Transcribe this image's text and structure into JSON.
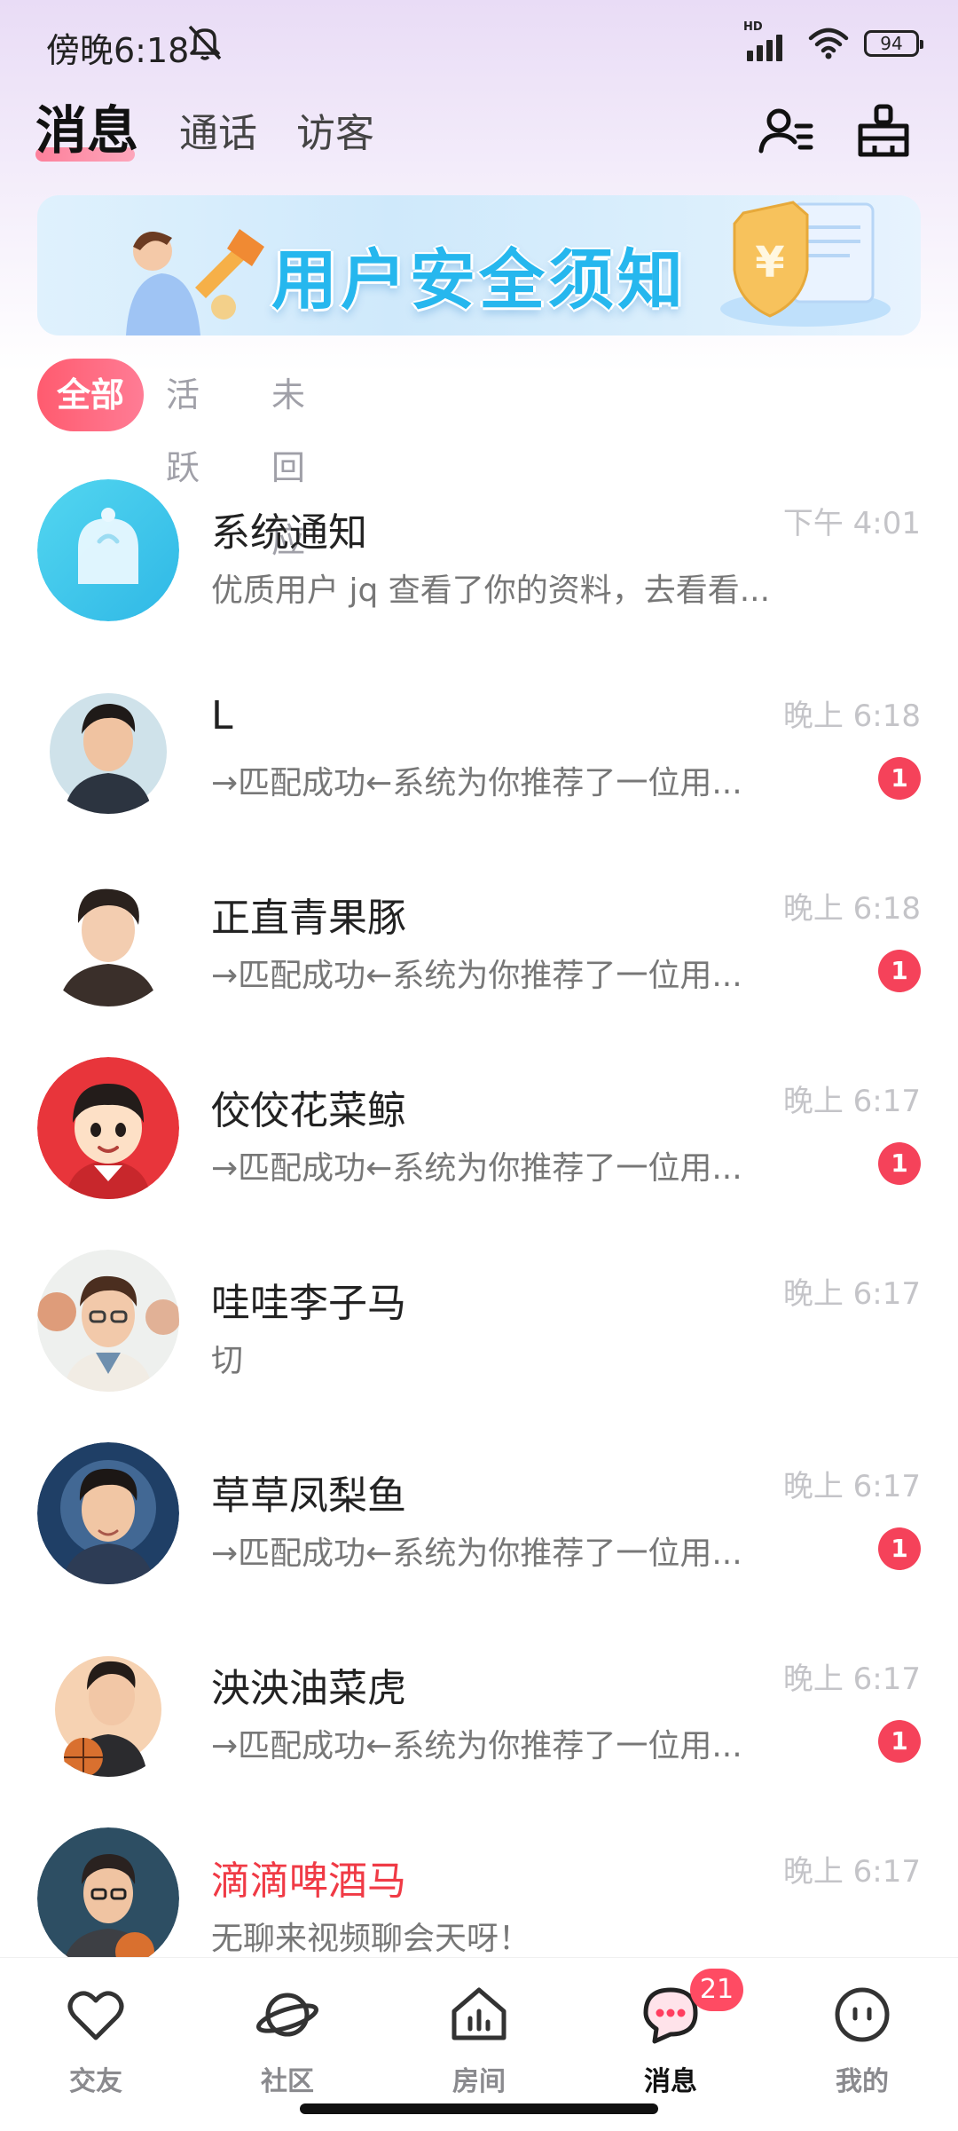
{
  "status_bar": {
    "time": "傍晚6:18",
    "network": "HD",
    "battery": "94"
  },
  "header": {
    "tabs": [
      {
        "label": "消息",
        "active": true
      },
      {
        "label": "通话",
        "active": false
      },
      {
        "label": "访客",
        "active": false
      }
    ],
    "icons": [
      "friends-list-icon",
      "clean-broom-icon"
    ]
  },
  "banner": {
    "text": "用户安全须知"
  },
  "filters": [
    {
      "label": "全部",
      "active": true
    },
    {
      "label": "活跃",
      "active": false
    },
    {
      "label": "未回应",
      "active": false
    }
  ],
  "conversations": [
    {
      "name": "系统通知",
      "preview": "优质用户 jq 查看了你的资料，去看看...",
      "time": "下午 4:01",
      "unread": null
    },
    {
      "name": "L",
      "preview": "→匹配成功←系统为你推荐了一位用...",
      "time": "晚上 6:18",
      "unread": "1"
    },
    {
      "name": "正直青果豚",
      "preview": "→匹配成功←系统为你推荐了一位用...",
      "time": "晚上 6:18",
      "unread": "1"
    },
    {
      "name": "佼佼花菜鲸",
      "preview": "→匹配成功←系统为你推荐了一位用...",
      "time": "晚上 6:17",
      "unread": "1"
    },
    {
      "name": "哇哇李子马",
      "preview": "切",
      "time": "晚上 6:17",
      "unread": null
    },
    {
      "name": "草草凤梨鱼",
      "preview": "→匹配成功←系统为你推荐了一位用...",
      "time": "晚上 6:17",
      "unread": "1"
    },
    {
      "name": "泱泱油菜虎",
      "preview": "→匹配成功←系统为你推荐了一位用...",
      "time": "晚上 6:17",
      "unread": "1"
    },
    {
      "name": "滴滴啤酒马",
      "preview": "无聊来视频聊会天呀！",
      "time": "晚上 6:17",
      "unread": null,
      "name_color": "#f03a45"
    }
  ],
  "bottom_nav": [
    {
      "label": "交友",
      "icon": "heart-icon",
      "active": false
    },
    {
      "label": "社区",
      "icon": "planet-icon",
      "active": false
    },
    {
      "label": "房间",
      "icon": "house-chart-icon",
      "active": false
    },
    {
      "label": "消息",
      "icon": "chat-bubble-icon",
      "active": true,
      "badge": "21"
    },
    {
      "label": "我的",
      "icon": "face-icon",
      "active": false
    }
  ],
  "colors": {
    "accent": "#ff5b6f",
    "badge": "#f5425a",
    "banner_text": "#26b7ee"
  }
}
